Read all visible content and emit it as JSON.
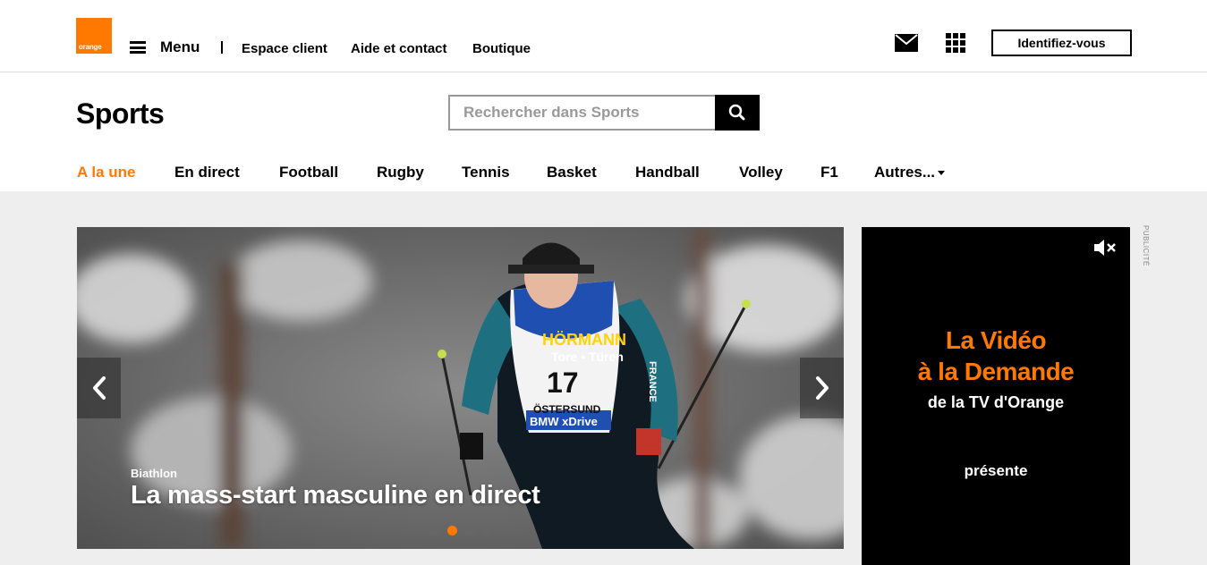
{
  "header": {
    "logo_text": "orange",
    "menu_label": "Menu",
    "links": [
      "Espace client",
      "Aide et contact",
      "Boutique"
    ],
    "login_label": "Identifiez-vous"
  },
  "section": {
    "title": "Sports",
    "search_placeholder": "Rechercher dans Sports"
  },
  "nav": {
    "items": [
      "A la une",
      "En direct",
      "Football",
      "Rugby",
      "Tennis",
      "Basket",
      "Handball",
      "Volley",
      "F1",
      "Autres..."
    ],
    "active_index": 0
  },
  "slider": {
    "category": "Biathlon",
    "title": "La mass-start masculine en direct",
    "dots": 4,
    "active_dot": 1,
    "bib_number": "17",
    "bib_sponsor": "HÖRMANN",
    "bib_sponsor_sub": "Tore • Türen",
    "bib_bottom": "ÖSTERSUND",
    "bib_brand": "BMW xDrive",
    "sleeve_text": "FRANCE"
  },
  "ad": {
    "line1": "La Vidéo",
    "line2": "à la Demande",
    "line3": "de la TV d'Orange",
    "line4": "présente",
    "label": "PUBLICITÉ"
  },
  "colors": {
    "brand": "#ff7900",
    "content_bg": "#eeeeee"
  }
}
